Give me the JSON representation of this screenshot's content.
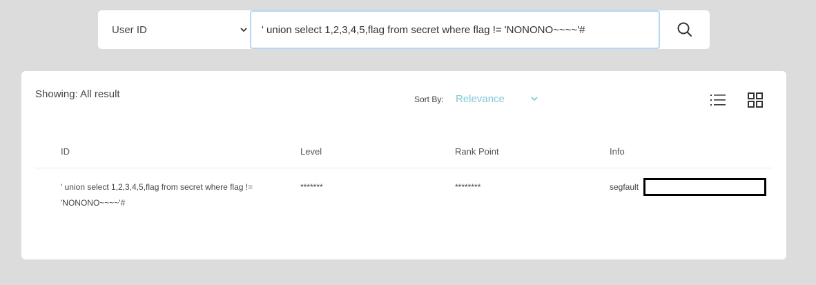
{
  "search": {
    "filter_selected": "User ID",
    "query_value": "' union select 1,2,3,4,5,flag from secret where flag != 'NONONO~~~~'#",
    "search_icon": "search-icon"
  },
  "results": {
    "showing_text": "Showing: All result",
    "sort_label": "Sort By:",
    "sort_value": "Relevance",
    "view_icons": [
      "list-view-icon",
      "grid-view-icon"
    ],
    "columns": [
      "ID",
      "Level",
      "Rank Point",
      "Info"
    ],
    "rows": [
      {
        "id": "' union select 1,2,3,4,5,flag from secret where flag != 'NONONO~~~~'#",
        "level": "*******",
        "rank_point": "********",
        "info": "segfault"
      }
    ]
  },
  "colors": {
    "background": "#dcdcdc",
    "panel": "#ffffff",
    "accent": "#7ec8d6",
    "input_border": "#b3d7f5"
  }
}
